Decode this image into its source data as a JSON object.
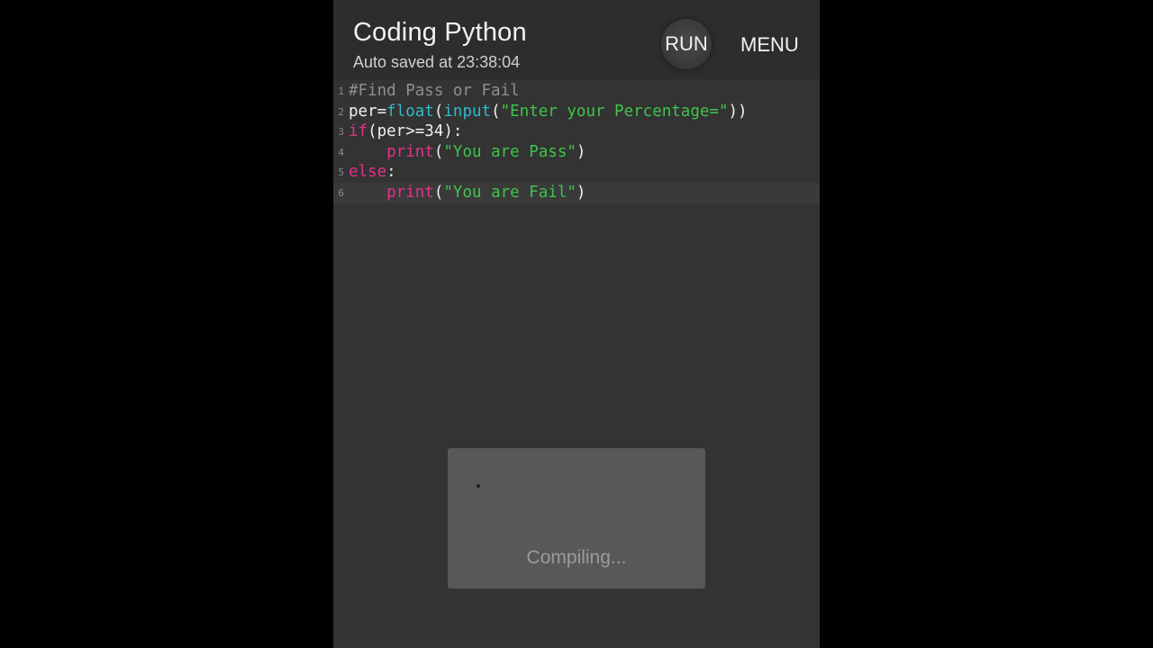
{
  "app": {
    "title": "Coding Python",
    "autosave_text": "Auto saved at 23:38:04",
    "run_label": "RUN",
    "menu_label": "MENU"
  },
  "editor": {
    "lines": [
      {
        "number": "1",
        "tokens": [
          {
            "type": "comment",
            "text": "#Find Pass or Fail"
          }
        ]
      },
      {
        "number": "2",
        "tokens": [
          {
            "type": "plain",
            "text": "per="
          },
          {
            "type": "fn",
            "text": "float"
          },
          {
            "type": "plain",
            "text": "("
          },
          {
            "type": "fn",
            "text": "input"
          },
          {
            "type": "plain",
            "text": "("
          },
          {
            "type": "str",
            "text": "\"Enter your Percentage=\""
          },
          {
            "type": "plain",
            "text": "))"
          }
        ]
      },
      {
        "number": "3",
        "tokens": [
          {
            "type": "kw",
            "text": "if"
          },
          {
            "type": "plain",
            "text": "(per>=34):"
          }
        ]
      },
      {
        "number": "4",
        "tokens": [
          {
            "type": "plain",
            "text": "    "
          },
          {
            "type": "kw",
            "text": "print"
          },
          {
            "type": "plain",
            "text": "("
          },
          {
            "type": "str",
            "text": "\"You are Pass\""
          },
          {
            "type": "plain",
            "text": ")"
          }
        ]
      },
      {
        "number": "5",
        "tokens": [
          {
            "type": "kw",
            "text": "else"
          },
          {
            "type": "plain",
            "text": ":"
          }
        ]
      },
      {
        "number": "6",
        "active": true,
        "tokens": [
          {
            "type": "plain",
            "text": "    "
          },
          {
            "type": "kw",
            "text": "print"
          },
          {
            "type": "plain",
            "text": "("
          },
          {
            "type": "str",
            "text": "\"You are Fail\""
          },
          {
            "type": "plain",
            "text": ")"
          }
        ]
      }
    ]
  },
  "dialog": {
    "status_text": "Compiling...",
    "spinner_icon": "loading-spinner-icon"
  },
  "colors": {
    "keyword": "#e0328a",
    "function": "#33b8c8",
    "string": "#3ec44a",
    "comment": "#8f8f8f",
    "background": "#333333"
  }
}
